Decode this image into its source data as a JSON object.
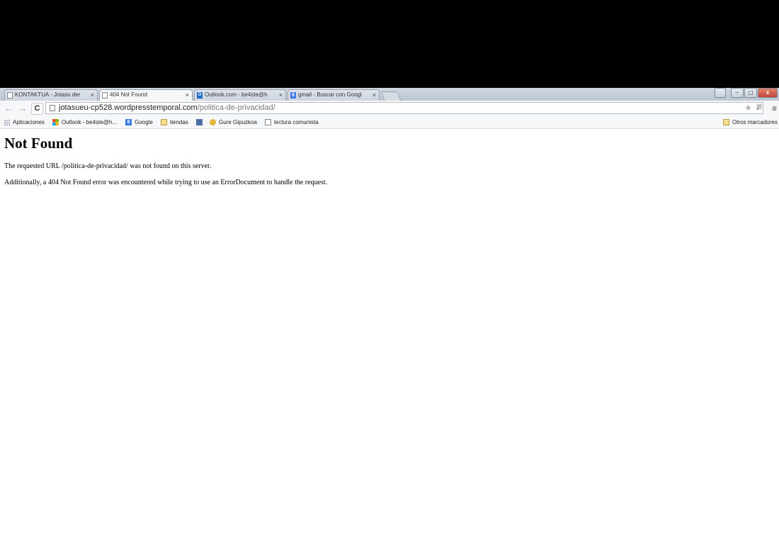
{
  "tabs": [
    {
      "label": "KONTAKTUA - Jotasu der",
      "icon": "page-icon",
      "active": false
    },
    {
      "label": "404 Not Found",
      "icon": "page-icon",
      "active": true
    },
    {
      "label": "Outlook.com - be4ste@h",
      "icon": "outlook-icon",
      "active": false
    },
    {
      "label": "gmail - Buscar con Googl",
      "icon": "google-icon",
      "active": false
    }
  ],
  "tab_close": "×",
  "window": {
    "minimize": "–",
    "maximize": "▢",
    "close": "x",
    "user": "👤"
  },
  "toolbar": {
    "back": "←",
    "forward": "→",
    "reload": "C",
    "url_host": "jotasueu-cp528.wordpresstemporal.com",
    "url_path": "/politica-de-privacidad/",
    "star": "★",
    "menu": "≡"
  },
  "bookmarks": [
    {
      "label": "Aplicaciones",
      "icon": "apps-icon"
    },
    {
      "label": "Outlook - be4ste@h...",
      "icon": "windows-icon"
    },
    {
      "label": "Google",
      "icon": "google-icon"
    },
    {
      "label": "tiendas",
      "icon": "folder-icon"
    },
    {
      "label": "",
      "icon": "bookmark-icon"
    },
    {
      "label": "Gure Gipuzkoa",
      "icon": "gure-icon"
    },
    {
      "label": "lectura comunista",
      "icon": "page-icon"
    }
  ],
  "other_bookmarks": "Otros marcadores",
  "page": {
    "title": "Not Found",
    "line1": "The requested URL /politica-de-privacidad/ was not found on this server.",
    "line2": "Additionally, a 404 Not Found error was encountered while trying to use an ErrorDocument to handle the request."
  }
}
